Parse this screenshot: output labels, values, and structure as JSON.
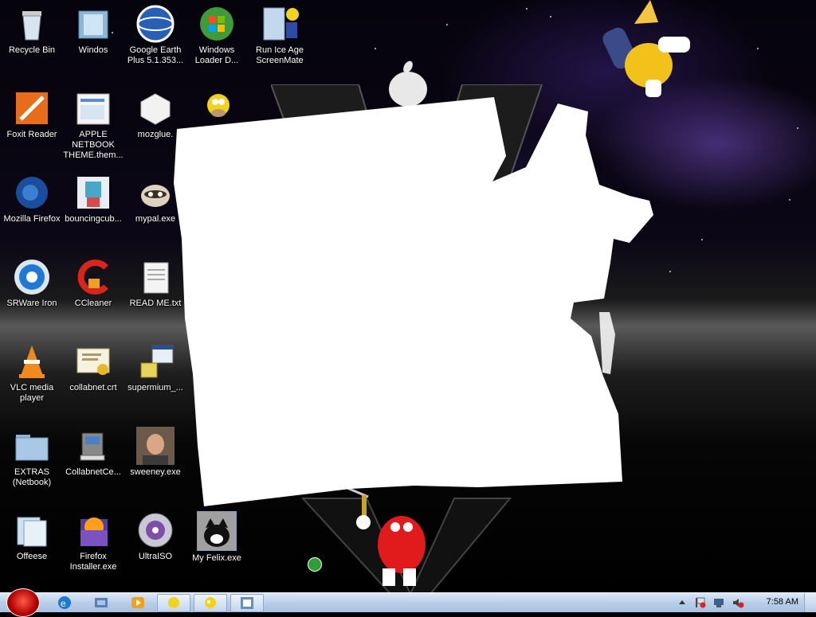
{
  "desktop": {
    "icons": [
      {
        "name": "recycle-bin",
        "label": "Recycle Bin"
      },
      {
        "name": "windos",
        "label": "Windos"
      },
      {
        "name": "google-earth",
        "label": "Google Earth Plus 5.1.353..."
      },
      {
        "name": "windows-loader",
        "label": "Windows Loader D..."
      },
      {
        "name": "ice-age",
        "label": "Run Ice Age ScreenMate"
      },
      {
        "name": "foxit-reader",
        "label": "Foxit Reader"
      },
      {
        "name": "apple-netbook",
        "label": "APPLE NETBOOK THEME.them..."
      },
      {
        "name": "mozglue",
        "label": "mozglue."
      },
      {
        "name": "mozilla-firefox",
        "label": "Mozilla Firefox"
      },
      {
        "name": "bouncingcub",
        "label": "bouncingcub..."
      },
      {
        "name": "mypal",
        "label": "mypal.exe"
      },
      {
        "name": "srware-iron",
        "label": "SRWare Iron"
      },
      {
        "name": "ccleaner",
        "label": "CCleaner"
      },
      {
        "name": "read-me",
        "label": "READ ME.txt"
      },
      {
        "name": "vlc",
        "label": "VLC media player"
      },
      {
        "name": "collabnet-crt",
        "label": "collabnet.crt"
      },
      {
        "name": "supermium",
        "label": "supermium_..."
      },
      {
        "name": "extras",
        "label": "EXTRAS (Netbook)"
      },
      {
        "name": "collabnetce",
        "label": "CollabnetCe..."
      },
      {
        "name": "sweeney",
        "label": "sweeney.exe"
      },
      {
        "name": "offeese",
        "label": "Offeese"
      },
      {
        "name": "firefox-installer",
        "label": "Firefox Installer.exe"
      },
      {
        "name": "ultraiso",
        "label": "UltraISO"
      },
      {
        "name": "my-felix",
        "label": "My Felix.exe"
      }
    ]
  },
  "taskbar": {
    "clock": "7:58 AM"
  }
}
